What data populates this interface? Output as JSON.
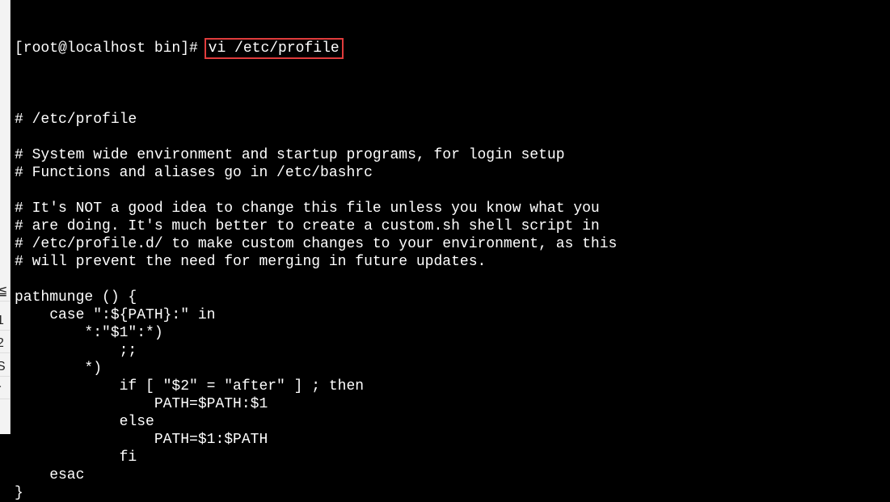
{
  "sidebar_strip": {
    "glyphs": [
      "≦",
      "1",
      "2",
      "S",
      "r"
    ]
  },
  "terminal": {
    "prompt": "[root@localhost bin]# ",
    "command": "vi /etc/profile",
    "highlight_color": "#e03c3c",
    "lines": [
      "",
      "# /etc/profile",
      "",
      "# System wide environment and startup programs, for login setup",
      "# Functions and aliases go in /etc/bashrc",
      "",
      "# It's NOT a good idea to change this file unless you know what you",
      "# are doing. It's much better to create a custom.sh shell script in",
      "# /etc/profile.d/ to make custom changes to your environment, as this",
      "# will prevent the need for merging in future updates.",
      "",
      "pathmunge () {",
      "    case \":${PATH}:\" in",
      "        *:\"$1\":*)",
      "            ;;",
      "        *)",
      "            if [ \"$2\" = \"after\" ] ; then",
      "                PATH=$PATH:$1",
      "            else",
      "                PATH=$1:$PATH",
      "            fi",
      "    esac",
      "}"
    ]
  }
}
